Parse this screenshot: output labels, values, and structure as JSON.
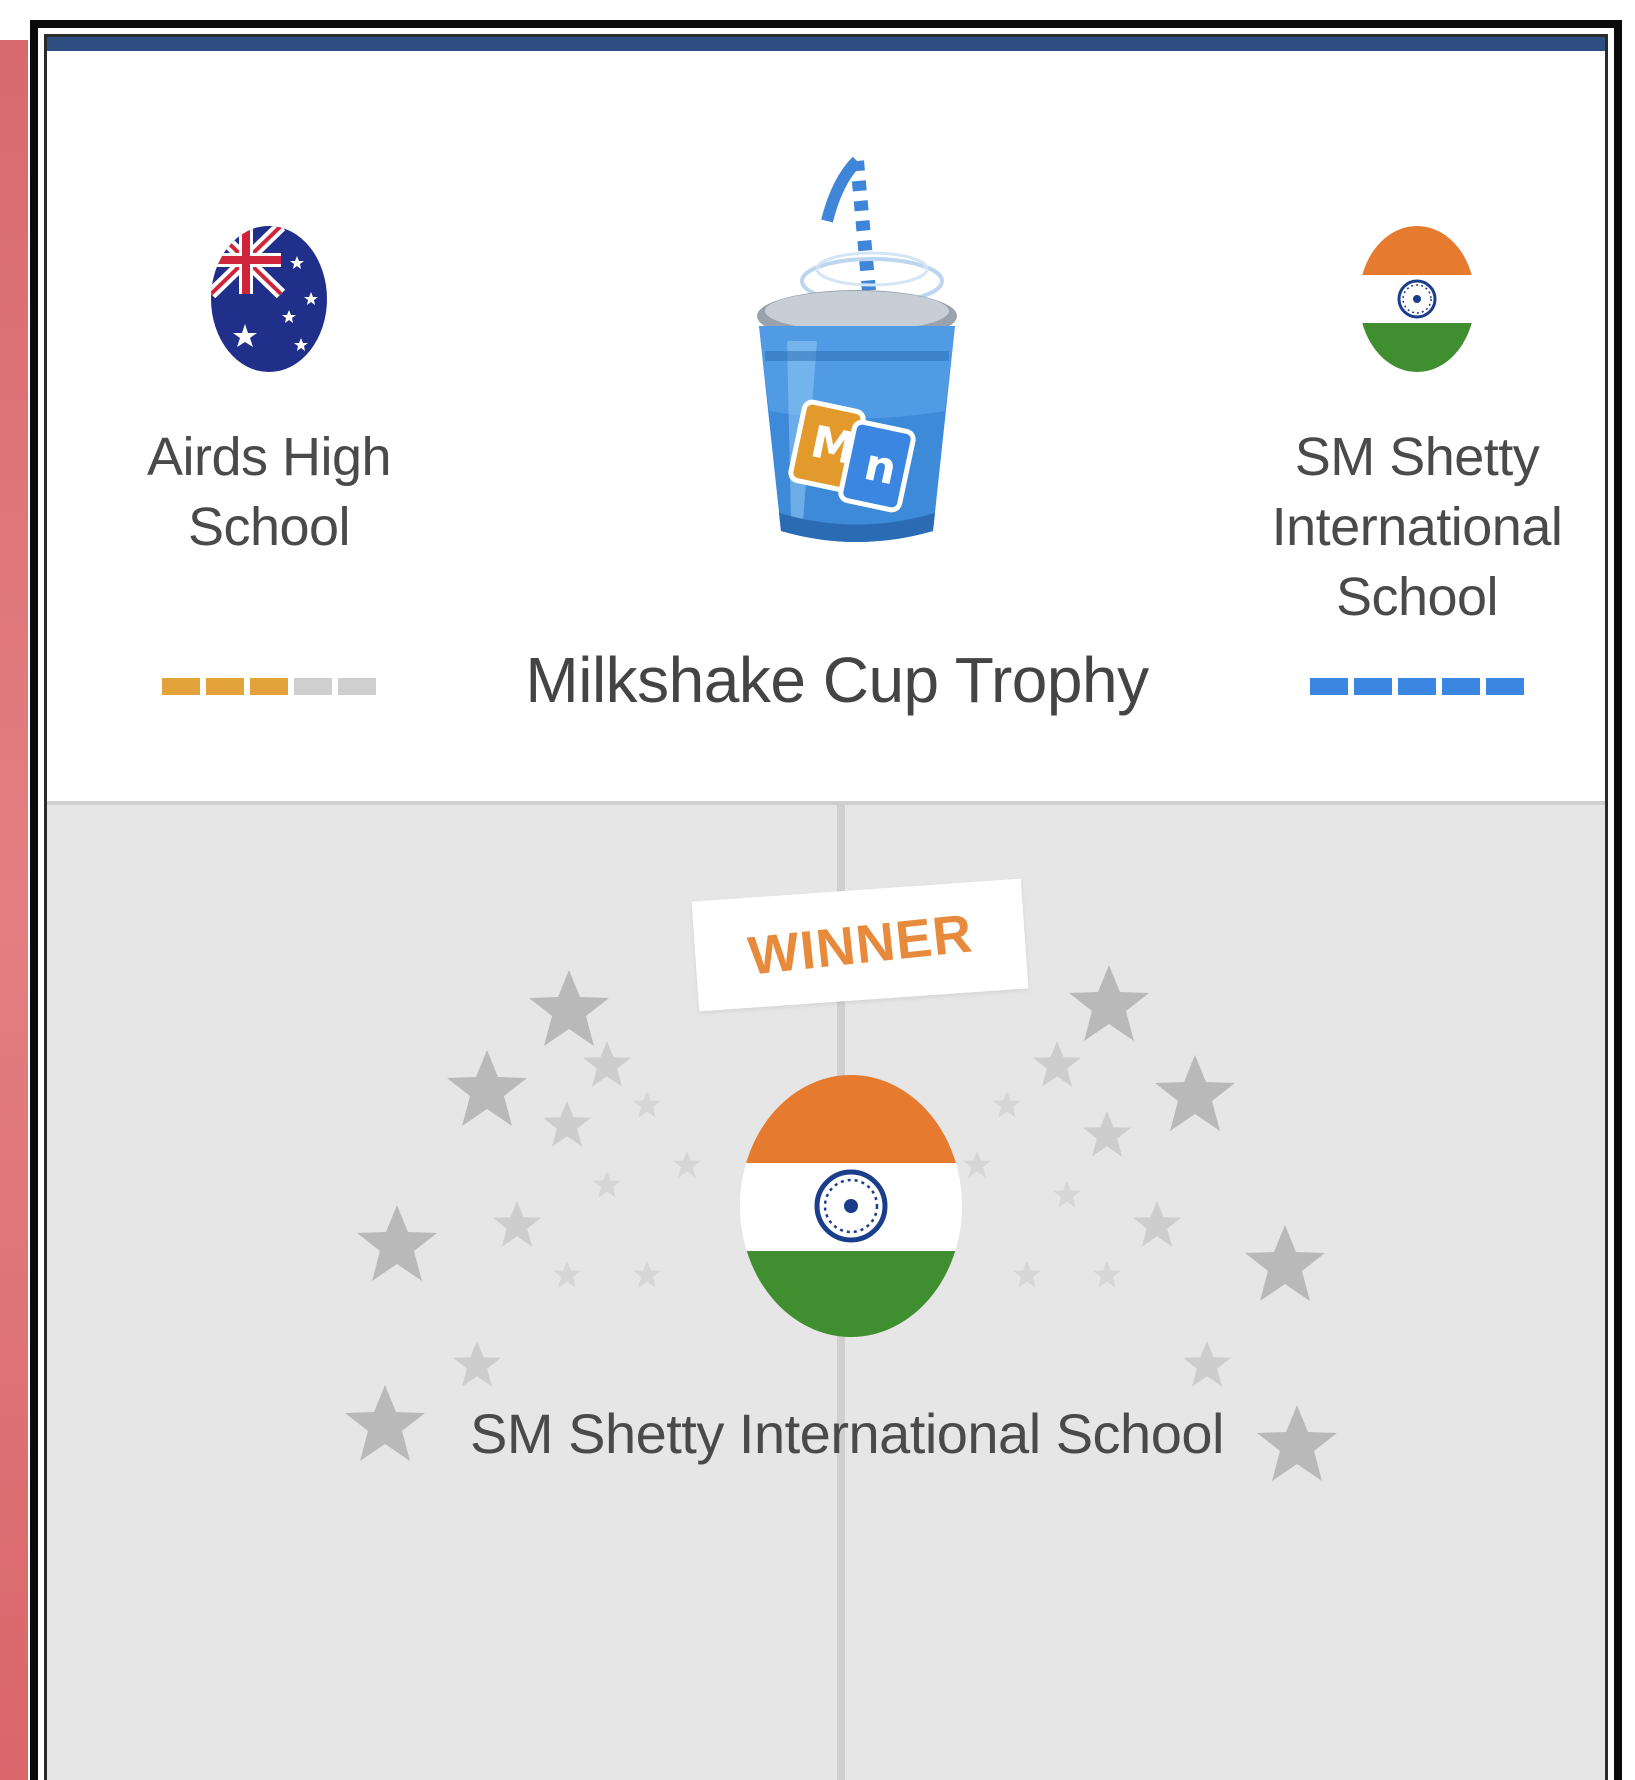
{
  "match": {
    "home": {
      "name": "Airds High School",
      "flag": "australia-flag-icon",
      "rating": 3,
      "rating_max": 5,
      "rating_color": "#e3a23a"
    },
    "away": {
      "name": "SM Shetty International School",
      "flag": "india-flag-icon",
      "rating": 5,
      "rating_max": 5,
      "rating_color": "#3a86e0"
    },
    "trophy": {
      "title": "Milkshake Cup Trophy",
      "icon": "milkshake-cup-icon",
      "logo_text": "Mn"
    }
  },
  "result": {
    "label": "WINNER",
    "team_name": "SM Shetty International School",
    "flag": "india-flag-icon"
  },
  "colors": {
    "accent_bar": "#2f4f82",
    "winner_label": "#e88a3c",
    "panel_bottom": "#e6e6e6",
    "india_saffron": "#e67a2e",
    "india_green": "#3f8e2f",
    "chakra_blue": "#1a3e8c"
  }
}
